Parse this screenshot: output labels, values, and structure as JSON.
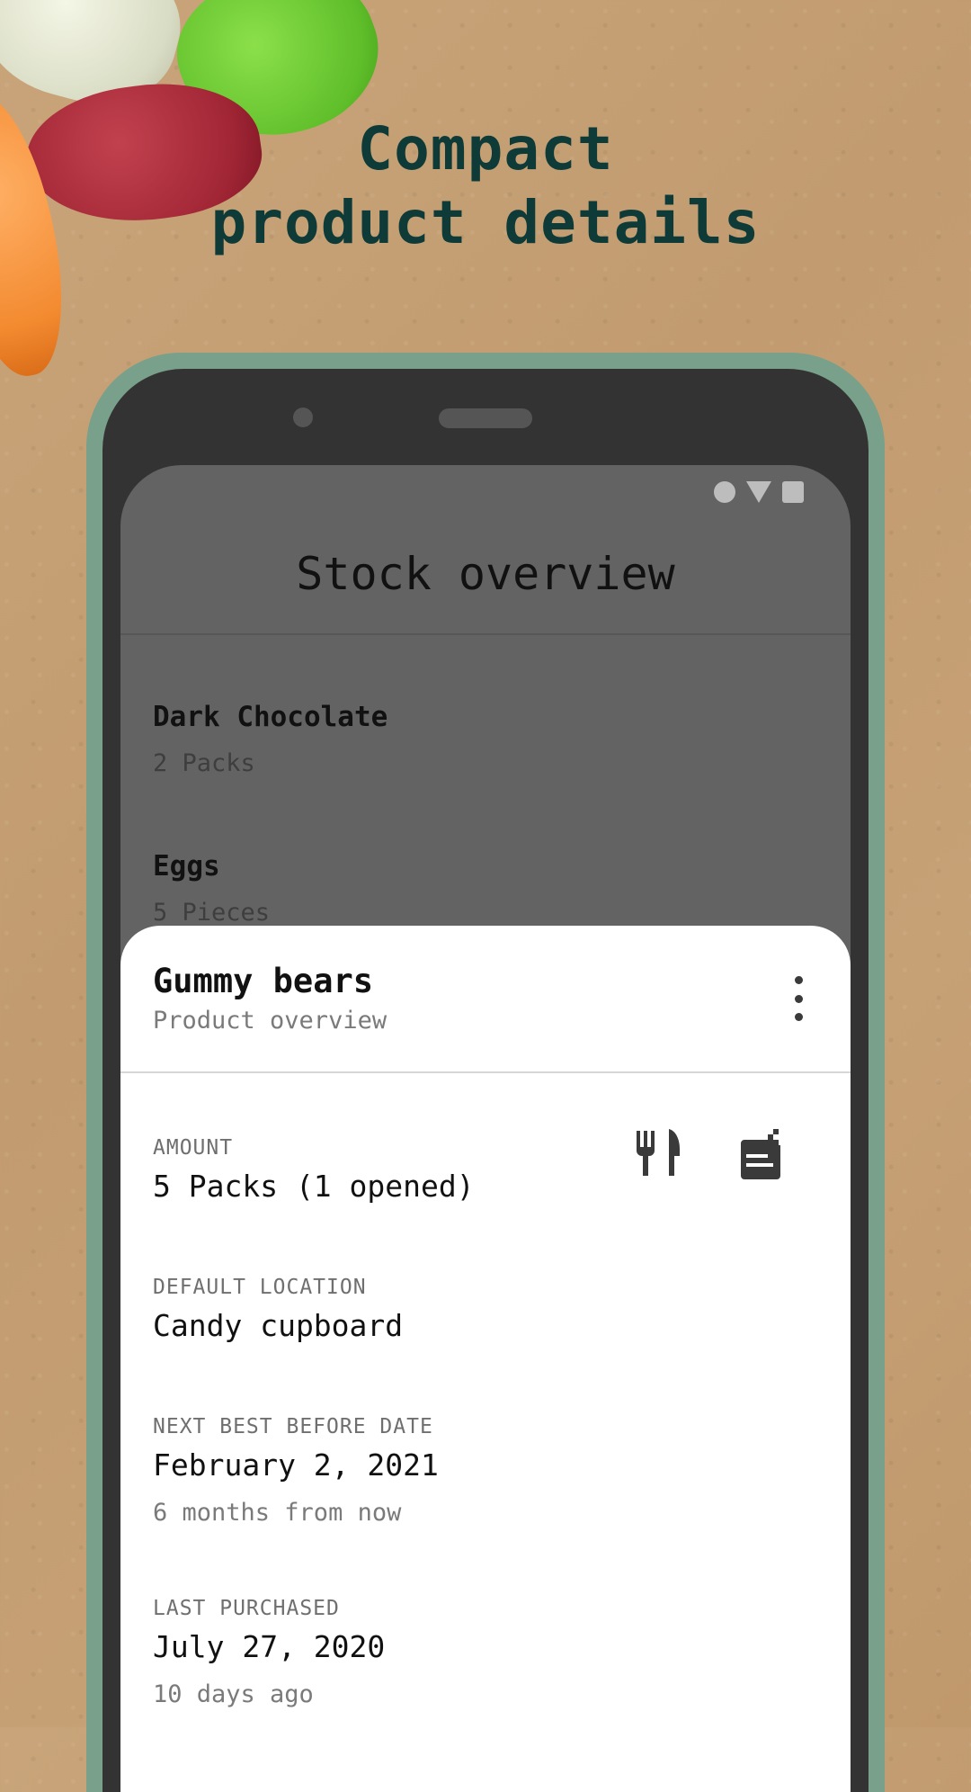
{
  "headline": {
    "line1": "Compact",
    "line2": "product details"
  },
  "status_icons": [
    "circle-icon",
    "signal-triangle-icon",
    "square-icon"
  ],
  "appbar": {
    "title": "Stock overview"
  },
  "stock_list": [
    {
      "name": "Dark Chocolate",
      "amount": "2 Packs"
    },
    {
      "name": "Eggs",
      "amount": "5 Pieces"
    }
  ],
  "sheet": {
    "title": "Gummy bears",
    "subtitle": "Product overview",
    "actions": [
      "consume-icon",
      "open-product-icon"
    ],
    "fields": {
      "amount": {
        "label": "AMOUNT",
        "value": "5 Packs (1 opened)"
      },
      "location": {
        "label": "DEFAULT LOCATION",
        "value": "Candy cupboard"
      },
      "best_before": {
        "label": "NEXT BEST BEFORE DATE",
        "value": "February 2, 2021",
        "note": "6 months from now"
      },
      "last_purchased": {
        "label": "LAST PURCHASED",
        "value": "July 27, 2020",
        "note": "10 days ago"
      }
    }
  },
  "colors": {
    "frame": "#78a08a",
    "headline": "#0e3b38",
    "scrim": "#636363"
  }
}
